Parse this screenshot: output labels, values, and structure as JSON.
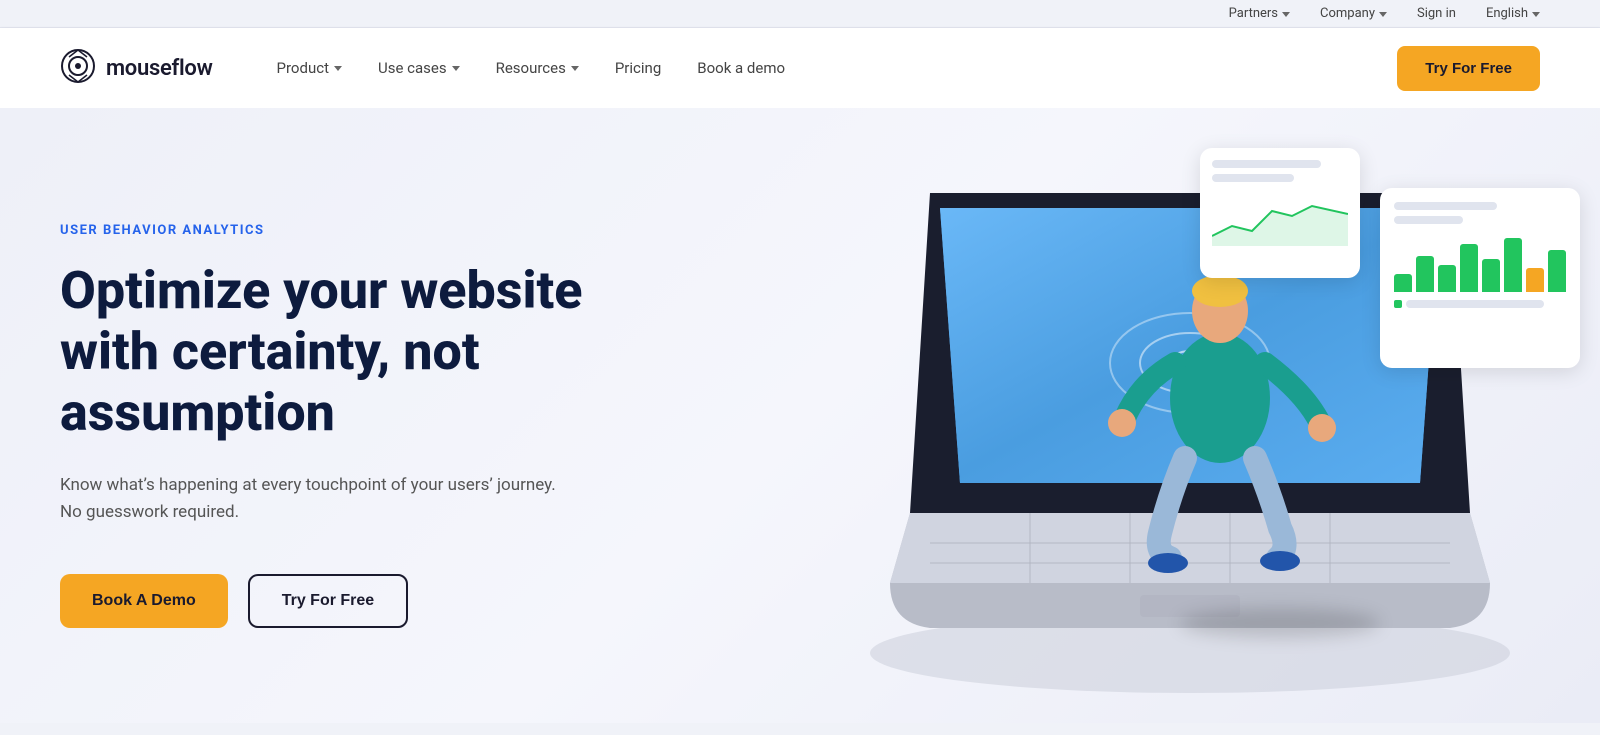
{
  "topbar": {
    "partners_label": "Partners",
    "company_label": "Company",
    "signin_label": "Sign in",
    "language_label": "English"
  },
  "navbar": {
    "logo_text": "mouseflow",
    "nav_items": [
      {
        "label": "Product",
        "has_dropdown": true
      },
      {
        "label": "Use cases",
        "has_dropdown": true
      },
      {
        "label": "Resources",
        "has_dropdown": true
      },
      {
        "label": "Pricing",
        "has_dropdown": false
      },
      {
        "label": "Book a demo",
        "has_dropdown": false
      }
    ],
    "cta_label": "Try For Free"
  },
  "hero": {
    "eyebrow": "USER BEHAVIOR ANALYTICS",
    "headline": "Optimize your website with certainty, not assumption",
    "subtext": "Know what’s happening at every touchpoint of your users’ journey. No guesswork required.",
    "btn_demo": "Book A Demo",
    "btn_free": "Try For Free"
  },
  "colors": {
    "accent_yellow": "#f5a623",
    "accent_blue": "#2563eb",
    "dark_navy": "#0d1b3e",
    "green": "#22c55e",
    "bar_green": "#22c55e",
    "bar_yellow": "#f5a623"
  }
}
